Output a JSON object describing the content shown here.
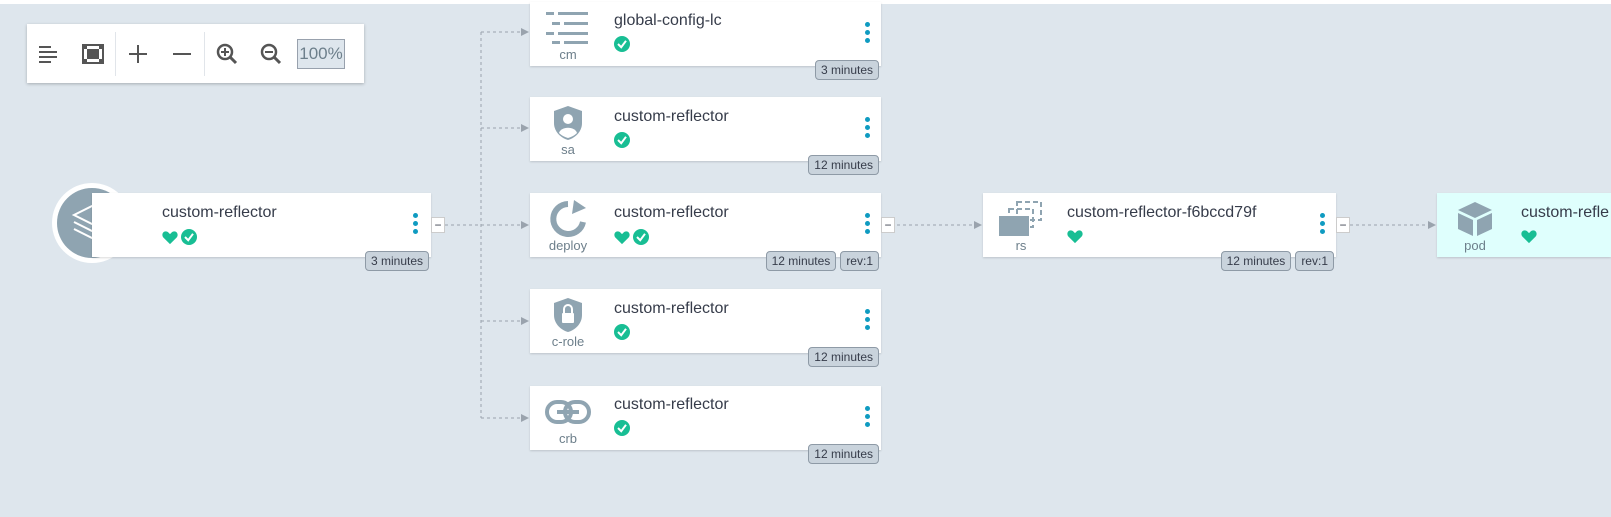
{
  "toolbar": {
    "zoom_label": "100%"
  },
  "app": {
    "name": "custom-reflector",
    "age": "3 minutes",
    "icon": "layers-icon"
  },
  "resources": [
    {
      "kind": "cm",
      "name": "global-config-lc",
      "age": "3 minutes",
      "icon": "configmap-icon"
    },
    {
      "kind": "sa",
      "name": "custom-reflector",
      "age": "12 minutes",
      "icon": "serviceaccount-icon"
    },
    {
      "kind": "deploy",
      "name": "custom-reflector",
      "age": "12 minutes",
      "rev": "rev:1",
      "icon": "deploy-icon"
    },
    {
      "kind": "c-role",
      "name": "custom-reflector",
      "age": "12 minutes",
      "icon": "clusterrole-icon"
    },
    {
      "kind": "crb",
      "name": "custom-reflector",
      "age": "12 minutes",
      "icon": "link-icon"
    }
  ],
  "replicaset": {
    "kind": "rs",
    "name": "custom-reflector-f6bccd79f",
    "age": "12 minutes",
    "rev": "rev:1",
    "icon": "replicaset-icon"
  },
  "pod": {
    "kind": "pod",
    "name": "custom-refle",
    "icon": "cube-icon"
  },
  "colors": {
    "healthy": "#18be94",
    "synced": "#18be94",
    "accent": "#0f9bc1",
    "background": "#dee6ed"
  }
}
